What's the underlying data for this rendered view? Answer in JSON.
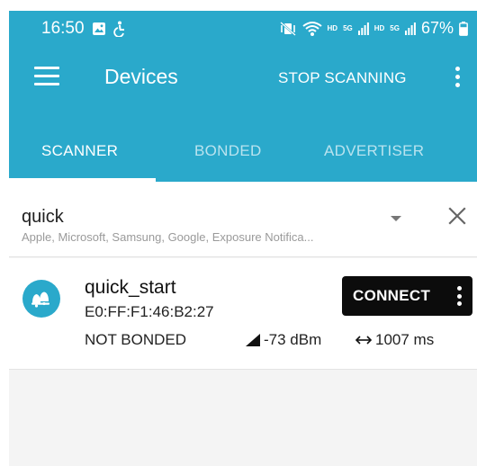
{
  "status_bar": {
    "time": "16:50",
    "battery": "67%",
    "icons": [
      "image-icon",
      "accessibility-icon",
      "mute-vibrate-icon",
      "wifi-icon",
      "hd-icon",
      "signal-5g-icon",
      "hd-icon",
      "signal-5g-icon",
      "battery-icon"
    ],
    "hd_label": "HD",
    "net_label": "5G"
  },
  "toolbar": {
    "title": "Devices",
    "stop_label": "STOP SCANNING"
  },
  "tabs": [
    {
      "label": "SCANNER",
      "active": true
    },
    {
      "label": "BONDED",
      "active": false
    },
    {
      "label": "ADVERTISER",
      "active": false
    }
  ],
  "filter": {
    "query": "quick",
    "subtitle": "Apple, Microsoft, Samsung, Google, Exposure Notifica..."
  },
  "devices": [
    {
      "name": "quick_start",
      "address": "E0:FF:F1:46:B2:27",
      "bond_state": "NOT BONDED",
      "rssi": "-73 dBm",
      "interval": "1007 ms",
      "connect_label": "CONNECT"
    }
  ],
  "colors": {
    "primary": "#2aa9cb",
    "button": "#0c0c0c",
    "background": "#f4f4f4"
  }
}
